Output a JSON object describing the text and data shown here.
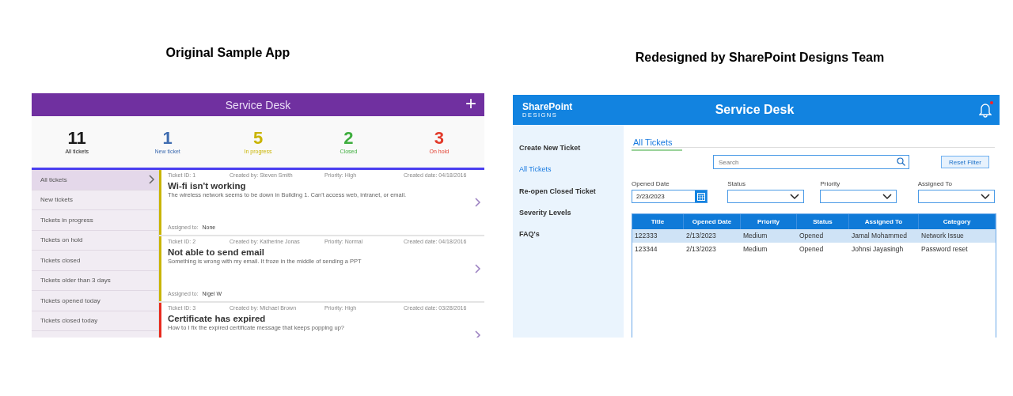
{
  "headings": [
    "Original Sample App",
    "Redesigned by SharePoint Designs Team"
  ],
  "original_app": {
    "title": "Service Desk",
    "add_button": "+",
    "stats": [
      {
        "count": "11",
        "label": "All tickets",
        "color": "#1a1a1a"
      },
      {
        "count": "1",
        "label": "New ticket",
        "color": "#3f6cb0"
      },
      {
        "count": "5",
        "label": "In progress",
        "color": "#c9b400"
      },
      {
        "count": "2",
        "label": "Closed",
        "color": "#3fae3f"
      },
      {
        "count": "3",
        "label": "On hold",
        "color": "#e23a2a"
      }
    ],
    "sidebar": [
      {
        "label": "All tickets",
        "selected": true
      },
      {
        "label": "New tickets",
        "selected": false
      },
      {
        "label": "Tickets in progress",
        "selected": false
      },
      {
        "label": "Tickets on hold",
        "selected": false
      },
      {
        "label": "Tickets closed",
        "selected": false
      },
      {
        "label": "Tickets older than 3 days",
        "selected": false
      },
      {
        "label": "Tickets opened today",
        "selected": false
      },
      {
        "label": "Tickets closed today",
        "selected": false
      }
    ],
    "tickets": [
      {
        "id": "Ticket ID: 1",
        "created_by": "Created by: Steven Smith",
        "priority": "Priority: High",
        "created_date": "Created date: 04/18/2016",
        "title": "Wi-fi isn't working",
        "description": "The wireless network seems to be down in Building 1. Can't access web, intranet, or email.",
        "assigned_label": "Assigned to:",
        "assigned": "None",
        "color": "#c9b400"
      },
      {
        "id": "Ticket ID: 2",
        "created_by": "Created by: Katherine Jonas",
        "priority": "Priority: Normal",
        "created_date": "Created date: 04/18/2016",
        "title": "Not able to send email",
        "description": "Something is wrong with my email. It froze in the middle of sending a PPT",
        "assigned_label": "Assigned to:",
        "assigned": "Nigel W",
        "color": "#c9b400"
      },
      {
        "id": "Ticket ID: 3",
        "created_by": "Created by: Michael Brown",
        "priority": "Priority: High",
        "created_date": "Created date: 03/28/2016",
        "title": "Certificate has expired",
        "description": "How to I fix the expired certificate message that keeps popping up?",
        "color": "#e82a1e"
      }
    ]
  },
  "redesigned_app": {
    "logo": "SharePoint",
    "logo_sub": "DESIGNS",
    "title": "Service Desk",
    "notification": true,
    "sidebar": [
      {
        "label": "Create New Ticket",
        "selected": false
      },
      {
        "label": "All Tickets",
        "selected": true
      },
      {
        "label": "Re-open Closed Ticket",
        "selected": false
      },
      {
        "label": "Severity Levels",
        "selected": false
      },
      {
        "label": "FAQ's",
        "selected": false
      }
    ],
    "tab": "All Tickets",
    "search": {
      "placeholder": "Search"
    },
    "reset_button": "Reset Filter",
    "filters": [
      {
        "label": "Opened Date",
        "kind": "date",
        "value": "2/23/2023"
      },
      {
        "label": "Status",
        "kind": "dropdown"
      },
      {
        "label": "Priority",
        "kind": "dropdown"
      },
      {
        "label": "Assigned To",
        "kind": "dropdown"
      }
    ],
    "table": {
      "columns": [
        "Title",
        "Opened Date",
        "Priority",
        "Status",
        "Assigned To",
        "Category"
      ],
      "rows": [
        {
          "cells": [
            "122333",
            "2/13/2023",
            "Medium",
            "Opened",
            "Jamal Mohammed",
            "Network Issue"
          ],
          "selected": true
        },
        {
          "cells": [
            "123344",
            "2/13/2023",
            "Medium",
            "Opened",
            "Johnsi Jayasingh",
            "Password reset"
          ],
          "selected": false
        }
      ]
    }
  }
}
